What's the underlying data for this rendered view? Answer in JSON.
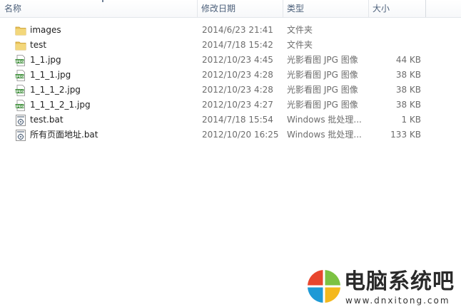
{
  "columns": {
    "name": "名称",
    "date": "修改日期",
    "type": "类型",
    "size": "大小"
  },
  "files": [
    {
      "name": "images",
      "date": "2014/6/23 21:41",
      "type": "文件夹",
      "size": "",
      "icon": "folder-icon"
    },
    {
      "name": "test",
      "date": "2014/7/18 15:42",
      "type": "文件夹",
      "size": "",
      "icon": "folder-icon"
    },
    {
      "name": "1_1.jpg",
      "date": "2012/10/23 4:45",
      "type": "光影看图 JPG 图像",
      "size": "44 KB",
      "icon": "jpeg-file-icon"
    },
    {
      "name": "1_1_1.jpg",
      "date": "2012/10/23 4:28",
      "type": "光影看图 JPG 图像",
      "size": "38 KB",
      "icon": "jpeg-file-icon"
    },
    {
      "name": "1_1_1_2.jpg",
      "date": "2012/10/23 4:28",
      "type": "光影看图 JPG 图像",
      "size": "38 KB",
      "icon": "jpeg-file-icon"
    },
    {
      "name": "1_1_1_2_1.jpg",
      "date": "2012/10/23 4:27",
      "type": "光影看图 JPG 图像",
      "size": "38 KB",
      "icon": "jpeg-file-icon"
    },
    {
      "name": "test.bat",
      "date": "2014/7/18 15:54",
      "type": "Windows 批处理...",
      "size": "1 KB",
      "icon": "batch-file-icon"
    },
    {
      "name": "所有页面地址.bat",
      "date": "2012/10/20 16:25",
      "type": "Windows 批处理...",
      "size": "133 KB",
      "icon": "batch-file-icon"
    }
  ],
  "watermark": {
    "title": "电脑系统吧",
    "url": "www.dnxitong.com"
  },
  "colors": {
    "header_text": "#4c607a",
    "detail_text": "#6d6d6d",
    "folder": "#e8c15a",
    "jpeg_badge": "#3f8f3b"
  }
}
